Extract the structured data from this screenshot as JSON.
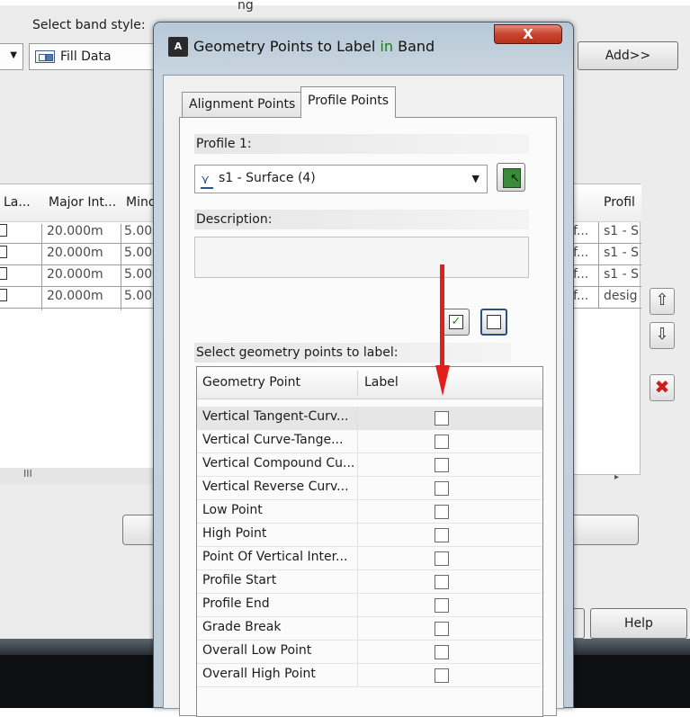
{
  "background_dialog": {
    "top_text": "ng",
    "select_band_style_label": "Select band style:",
    "band_style_value": "Fill Data",
    "add_button": "Add>>",
    "left_grid_headers": [
      "La...",
      "Major Int...",
      "Mino"
    ],
    "left_grid_rows": [
      {
        "major": "20.000m",
        "minor": "5.00"
      },
      {
        "major": "20.000m",
        "minor": "5.00"
      },
      {
        "major": "20.000m",
        "minor": "5.00"
      },
      {
        "major": "20.000m",
        "minor": "5.00"
      }
    ],
    "right_grid_header": "Profil",
    "right_grid_rows": [
      {
        "a": "f...",
        "b": "s1 - S"
      },
      {
        "a": "f...",
        "b": "s1 - S"
      },
      {
        "a": "f...",
        "b": "s1 - S"
      },
      {
        "a": "f...",
        "b": "desig"
      }
    ],
    "scroll_marker": "III",
    "help_button": "Help"
  },
  "dialog": {
    "title_prefix": "Geometry Points to Label ",
    "title_highlight": "in",
    "title_suffix": " Band",
    "close_label": "X",
    "tabs": [
      {
        "label": "Alignment Points",
        "active": false
      },
      {
        "label": "Profile Points",
        "active": true
      }
    ],
    "profile_label": "Profile 1:",
    "profile_value": "s1 - Surface (4)",
    "description_label": "Description:",
    "description_value": "",
    "select_points_label": "Select geometry points to label:",
    "grid_headers": {
      "point": "Geometry Point",
      "label": "Label"
    },
    "geometry_points": [
      {
        "name": "Vertical Tangent-Curv...",
        "checked": false,
        "selected": true
      },
      {
        "name": "Vertical Curve-Tange...",
        "checked": false,
        "selected": false
      },
      {
        "name": "Vertical Compound Cu...",
        "checked": false,
        "selected": false
      },
      {
        "name": "Vertical Reverse Curv...",
        "checked": false,
        "selected": false
      },
      {
        "name": "Low Point",
        "checked": false,
        "selected": false
      },
      {
        "name": "High Point",
        "checked": false,
        "selected": false
      },
      {
        "name": "Point Of Vertical Inter...",
        "checked": false,
        "selected": false
      },
      {
        "name": "Profile Start",
        "checked": false,
        "selected": false
      },
      {
        "name": "Profile End",
        "checked": false,
        "selected": false
      },
      {
        "name": "Grade Break",
        "checked": false,
        "selected": false
      },
      {
        "name": "Overall Low Point",
        "checked": false,
        "selected": false
      },
      {
        "name": "Overall High Point",
        "checked": false,
        "selected": false
      }
    ]
  },
  "colors": {
    "annotation_arrow": "#e0201b",
    "title_highlight": "#1a7a1a",
    "close_button": "#c8432d"
  }
}
